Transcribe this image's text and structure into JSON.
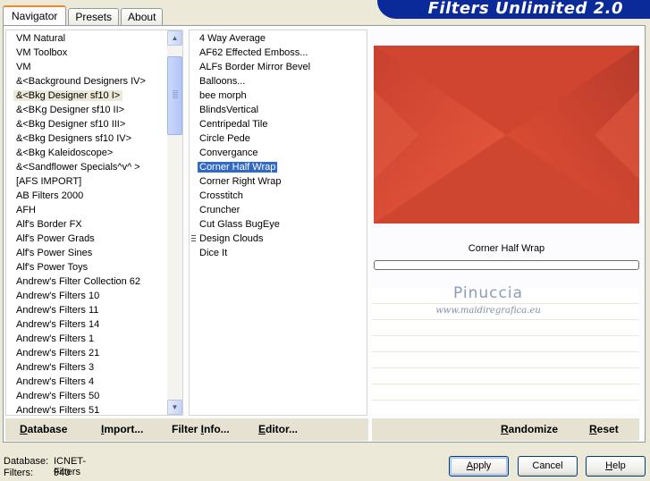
{
  "tabs": [
    "Navigator",
    "Presets",
    "About"
  ],
  "brand_title": "Filters Unlimited 2.0",
  "categories": [
    "VM Natural",
    "VM Toolbox",
    "VM",
    "&<Background Designers IV>",
    "&<Bkg Designer sf10 I>",
    "&<BKg Designer sf10 II>",
    "&<Bkg Designer sf10 III>",
    "&<Bkg Designers sf10 IV>",
    "&<Bkg Kaleidoscope>",
    "&<Sandflower Specials^v^ >",
    "[AFS IMPORT]",
    "AB Filters 2000",
    "AFH",
    "Alf's Border FX",
    "Alf's Power Grads",
    "Alf's Power Sines",
    "Alf's Power Toys",
    "Andrew's Filter Collection 62",
    "Andrew's Filters 10",
    "Andrew's Filters 11",
    "Andrew's Filters 14",
    "Andrew's Filters 1",
    "Andrew's Filters 21",
    "Andrew's Filters 3",
    "Andrew's Filters 4",
    "Andrew's Filters 50",
    "Andrew's Filters 51"
  ],
  "filters": [
    "4 Way Average",
    "AF62 Effected Emboss...",
    "ALFs Border Mirror Bevel",
    "Balloons...",
    "bee morph",
    "BlindsVertical",
    "Centripedal Tile",
    "Circle Pede",
    "Convergance",
    "Corner Half Wrap",
    "Corner Right Wrap",
    "Crosstitch",
    "Cruncher",
    "Cut Glass  BugEye",
    "Design Clouds",
    "Dice It"
  ],
  "selected_category_index": 4,
  "selected_filter_index": 9,
  "preview_filter_name": "Corner Half Wrap",
  "watermark": {
    "name": "Pinuccia",
    "site": "www.maidiregrafica.eu"
  },
  "commands_left": [
    "Database",
    "Import...",
    "Filter Info...",
    "Editor..."
  ],
  "commands_right": [
    "Randomize",
    "Reset"
  ],
  "status": {
    "database_label": "Database:",
    "database_value": "ICNET-Filters",
    "filters_label": "Filters:",
    "filters_value": "940"
  },
  "buttons": {
    "apply": "Apply",
    "cancel": "Cancel",
    "help": "Help"
  },
  "colors": {
    "preview_red": "#d84a36",
    "selection_blue": "#316ac5",
    "banner_blue": "#0a2a9a"
  }
}
